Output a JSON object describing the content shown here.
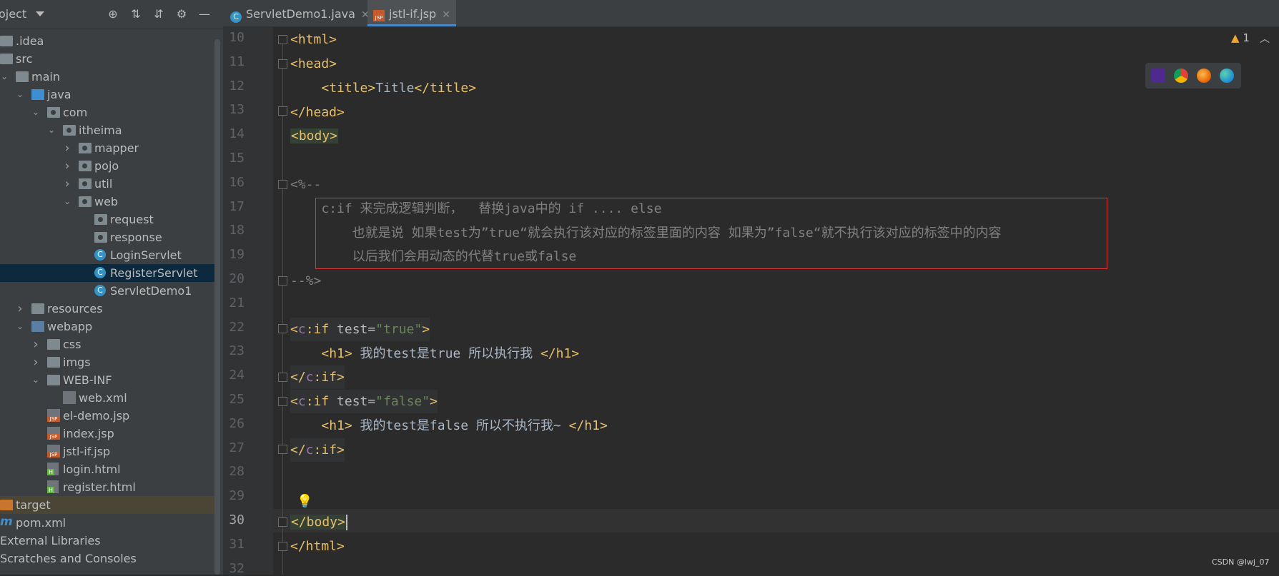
{
  "sidebar": {
    "title": "oject",
    "tree": [
      {
        "label": ".idea",
        "icon": "folder-icon",
        "level": 0
      },
      {
        "label": "src",
        "icon": "folder-icon",
        "level": 0
      },
      {
        "label": "main",
        "icon": "folder-icon",
        "level": 1
      },
      {
        "label": "java",
        "icon": "source-folder-icon",
        "level": 2
      },
      {
        "label": "com",
        "icon": "package-icon",
        "level": 3
      },
      {
        "label": "itheima",
        "icon": "package-icon",
        "level": 4
      },
      {
        "label": "mapper",
        "icon": "package-icon",
        "level": 5
      },
      {
        "label": "pojo",
        "icon": "package-icon",
        "level": 5
      },
      {
        "label": "util",
        "icon": "package-icon",
        "level": 5
      },
      {
        "label": "web",
        "icon": "package-icon",
        "level": 5
      },
      {
        "label": "request",
        "icon": "package-icon",
        "level": 6
      },
      {
        "label": "response",
        "icon": "package-icon",
        "level": 6
      },
      {
        "label": "LoginServlet",
        "icon": "java-class-icon",
        "level": 6
      },
      {
        "label": "RegisterServlet",
        "icon": "java-class-icon",
        "level": 6
      },
      {
        "label": "ServletDemo1",
        "icon": "java-class-icon",
        "level": 6
      },
      {
        "label": "resources",
        "icon": "resources-folder-icon",
        "level": 2
      },
      {
        "label": "webapp",
        "icon": "web-folder-icon",
        "level": 2
      },
      {
        "label": "css",
        "icon": "folder-icon",
        "level": 3
      },
      {
        "label": "imgs",
        "icon": "folder-icon",
        "level": 3
      },
      {
        "label": "WEB-INF",
        "icon": "folder-icon",
        "level": 3
      },
      {
        "label": "web.xml",
        "icon": "xml-file-icon",
        "level": 4
      },
      {
        "label": "el-demo.jsp",
        "icon": "jsp-file-icon",
        "level": 3
      },
      {
        "label": "index.jsp",
        "icon": "jsp-file-icon",
        "level": 3
      },
      {
        "label": "jstl-if.jsp",
        "icon": "jsp-file-icon",
        "level": 3
      },
      {
        "label": "login.html",
        "icon": "html-file-icon",
        "level": 3
      },
      {
        "label": "register.html",
        "icon": "html-file-icon",
        "level": 3
      },
      {
        "label": "target",
        "icon": "excluded-folder-icon",
        "level": 0
      },
      {
        "label": "pom.xml",
        "icon": "maven-icon",
        "level": 0
      },
      {
        "label": "External Libraries",
        "icon": "",
        "level": 0
      },
      {
        "label": "Scratches and Consoles",
        "icon": "",
        "level": 0
      }
    ]
  },
  "tabs": [
    {
      "label": "ServletDemo1.java",
      "icon": "java-class-icon",
      "active": false
    },
    {
      "label": "jstl-if.jsp",
      "icon": "jsp-file-icon",
      "active": true
    }
  ],
  "editor": {
    "line_numbers": [
      "10",
      "11",
      "12",
      "13",
      "14",
      "15",
      "16",
      "17",
      "18",
      "19",
      "20",
      "21",
      "22",
      "23",
      "24",
      "25",
      "26",
      "27",
      "28",
      "29",
      "30",
      "31",
      "32"
    ],
    "current_line": "30",
    "inspection_count": "1",
    "comment_lines": [
      "c:if 来完成逻辑判断，  替换java中的 if .... else",
      "    也就是说 如果test为”true“就会执行该对应的标签里面的内容 如果为”false“就不执行该对应的标签中的内容",
      "    以后我们会用动态的代替true或false"
    ],
    "h1_true_text": " 我的test是true 所以执行我 ",
    "h1_false_text": " 我的test是false 所以不执行我~ ",
    "title_text": "Title",
    "attr_true": "\"true\"",
    "attr_false": "\"false\""
  },
  "watermark": "CSDN @lwj_07"
}
